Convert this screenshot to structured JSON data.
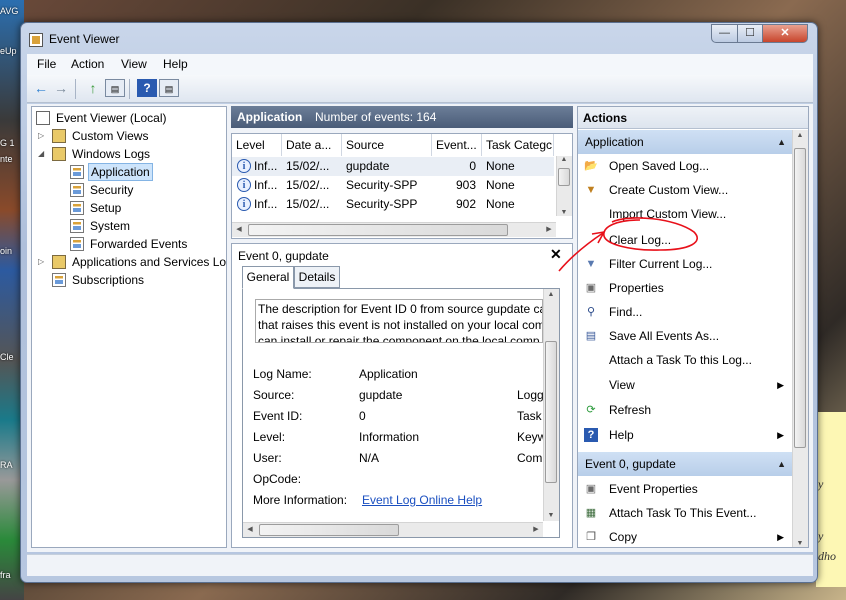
{
  "desktop": {
    "left_labels": [
      "AVG",
      "eUp",
      "G 1",
      "nte",
      "oin",
      "Cle",
      "RA",
      "fra"
    ],
    "sticky_lines": [
      "y",
      "y",
      "dho"
    ]
  },
  "window": {
    "title": "Event Viewer",
    "min_label": "—",
    "max_label": "☐",
    "close_label": "✕"
  },
  "menu": {
    "file": "File",
    "action": "Action",
    "view": "View",
    "help": "Help"
  },
  "toolbar": {
    "back_icon": "←",
    "forward_icon": "→",
    "up_icon": "↑",
    "help_icon": "?"
  },
  "tree": {
    "root": "Event Viewer (Local)",
    "custom_views": "Custom Views",
    "windows_logs": "Windows Logs",
    "application": "Application",
    "security": "Security",
    "setup": "Setup",
    "system": "System",
    "forwarded": "Forwarded Events",
    "apps_services": "Applications and Services Lo",
    "subscriptions": "Subscriptions"
  },
  "log_header": {
    "name": "Application",
    "count": "Number of events: 164"
  },
  "event_columns": [
    "Level",
    "Date a...",
    "Source",
    "Event...",
    "Task Categc"
  ],
  "events": [
    {
      "level": "Inf...",
      "date": "15/02/...",
      "source": "gupdate",
      "event_id": "0",
      "task": "None"
    },
    {
      "level": "Inf...",
      "date": "15/02/...",
      "source": "Security-SPP",
      "event_id": "903",
      "task": "None"
    },
    {
      "level": "Inf...",
      "date": "15/02/...",
      "source": "Security-SPP",
      "event_id": "902",
      "task": "None"
    }
  ],
  "detail": {
    "title": "Event 0, gupdate",
    "close": "✕",
    "tab_general": "General",
    "tab_details": "Details",
    "desc_line1": "The description for Event ID 0 from source gupdate ca",
    "desc_line2": "that raises this event is not installed on your local com",
    "desc_line3": "can install or repair the component on the local comp",
    "log_name_label": "Log Name:",
    "log_name_value": "Application",
    "source_label": "Source:",
    "source_value": "gupdate",
    "logged_label": "Logg",
    "event_id_label": "Event ID:",
    "event_id_value": "0",
    "task_label": "Task",
    "level_label": "Level:",
    "level_value": "Information",
    "keywords_label": "Keyw",
    "user_label": "User:",
    "user_value": "N/A",
    "computer_label": "Com",
    "opcode_label": "OpCode:",
    "more_info_label": "More Information:",
    "more_info_link": "Event Log Online Help"
  },
  "actions": {
    "header": "Actions",
    "section_app": "Application",
    "items_app": [
      {
        "icon": "open-folder-icon",
        "label": "Open Saved Log..."
      },
      {
        "icon": "filter-icon",
        "label": "Create Custom View..."
      },
      {
        "icon": "none",
        "label": "Import Custom View..."
      },
      {
        "icon": "none",
        "label": "Clear Log..."
      },
      {
        "icon": "filter-icon",
        "label": "Filter Current Log..."
      },
      {
        "icon": "properties-icon",
        "label": "Properties"
      },
      {
        "icon": "find-icon",
        "label": "Find..."
      },
      {
        "icon": "save-icon",
        "label": "Save All Events As..."
      },
      {
        "icon": "none",
        "label": "Attach a Task To this Log..."
      },
      {
        "icon": "none",
        "label": "View"
      },
      {
        "icon": "refresh-icon",
        "label": "Refresh"
      },
      {
        "icon": "help-icon",
        "label": "Help"
      }
    ],
    "section_event": "Event 0, gupdate",
    "items_event": [
      {
        "icon": "properties-icon",
        "label": "Event Properties"
      },
      {
        "icon": "task-icon",
        "label": "Attach Task To This Event..."
      },
      {
        "icon": "copy-icon",
        "label": "Copy"
      }
    ]
  },
  "colors": {
    "annotation": "#e8101a",
    "selection": "#cde4fb",
    "link": "#1a4fc0"
  }
}
